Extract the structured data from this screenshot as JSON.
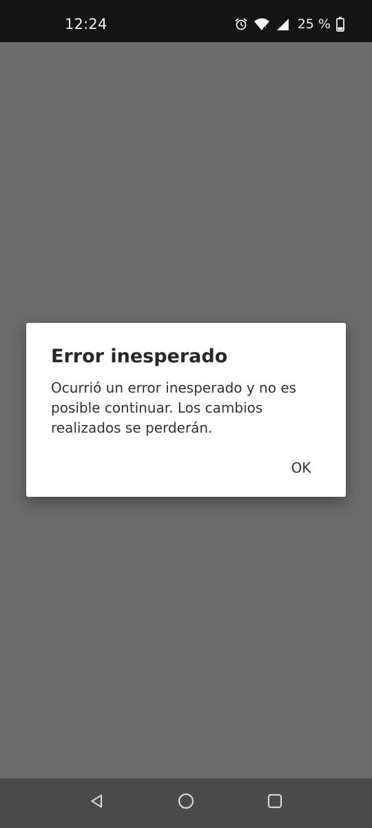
{
  "status_bar": {
    "time": "12:24",
    "battery_text": "25 %",
    "icons": [
      "alarm-icon",
      "wifi-icon",
      "signal-icon",
      "battery-icon"
    ]
  },
  "dialog": {
    "title": "Error inesperado",
    "message": "Ocurrió un error inesperado y no es posible continuar. Los cambios realizados se perderán.",
    "ok_label": "OK"
  },
  "nav_bar": {
    "icons": [
      "back-icon",
      "home-icon",
      "recents-icon"
    ]
  },
  "colors": {
    "scrim": "#6b6b6b",
    "status_bar": "#151515",
    "nav_bar": "#4a4a4a",
    "dialog_bg": "#ffffff",
    "title_text": "#26292c"
  }
}
